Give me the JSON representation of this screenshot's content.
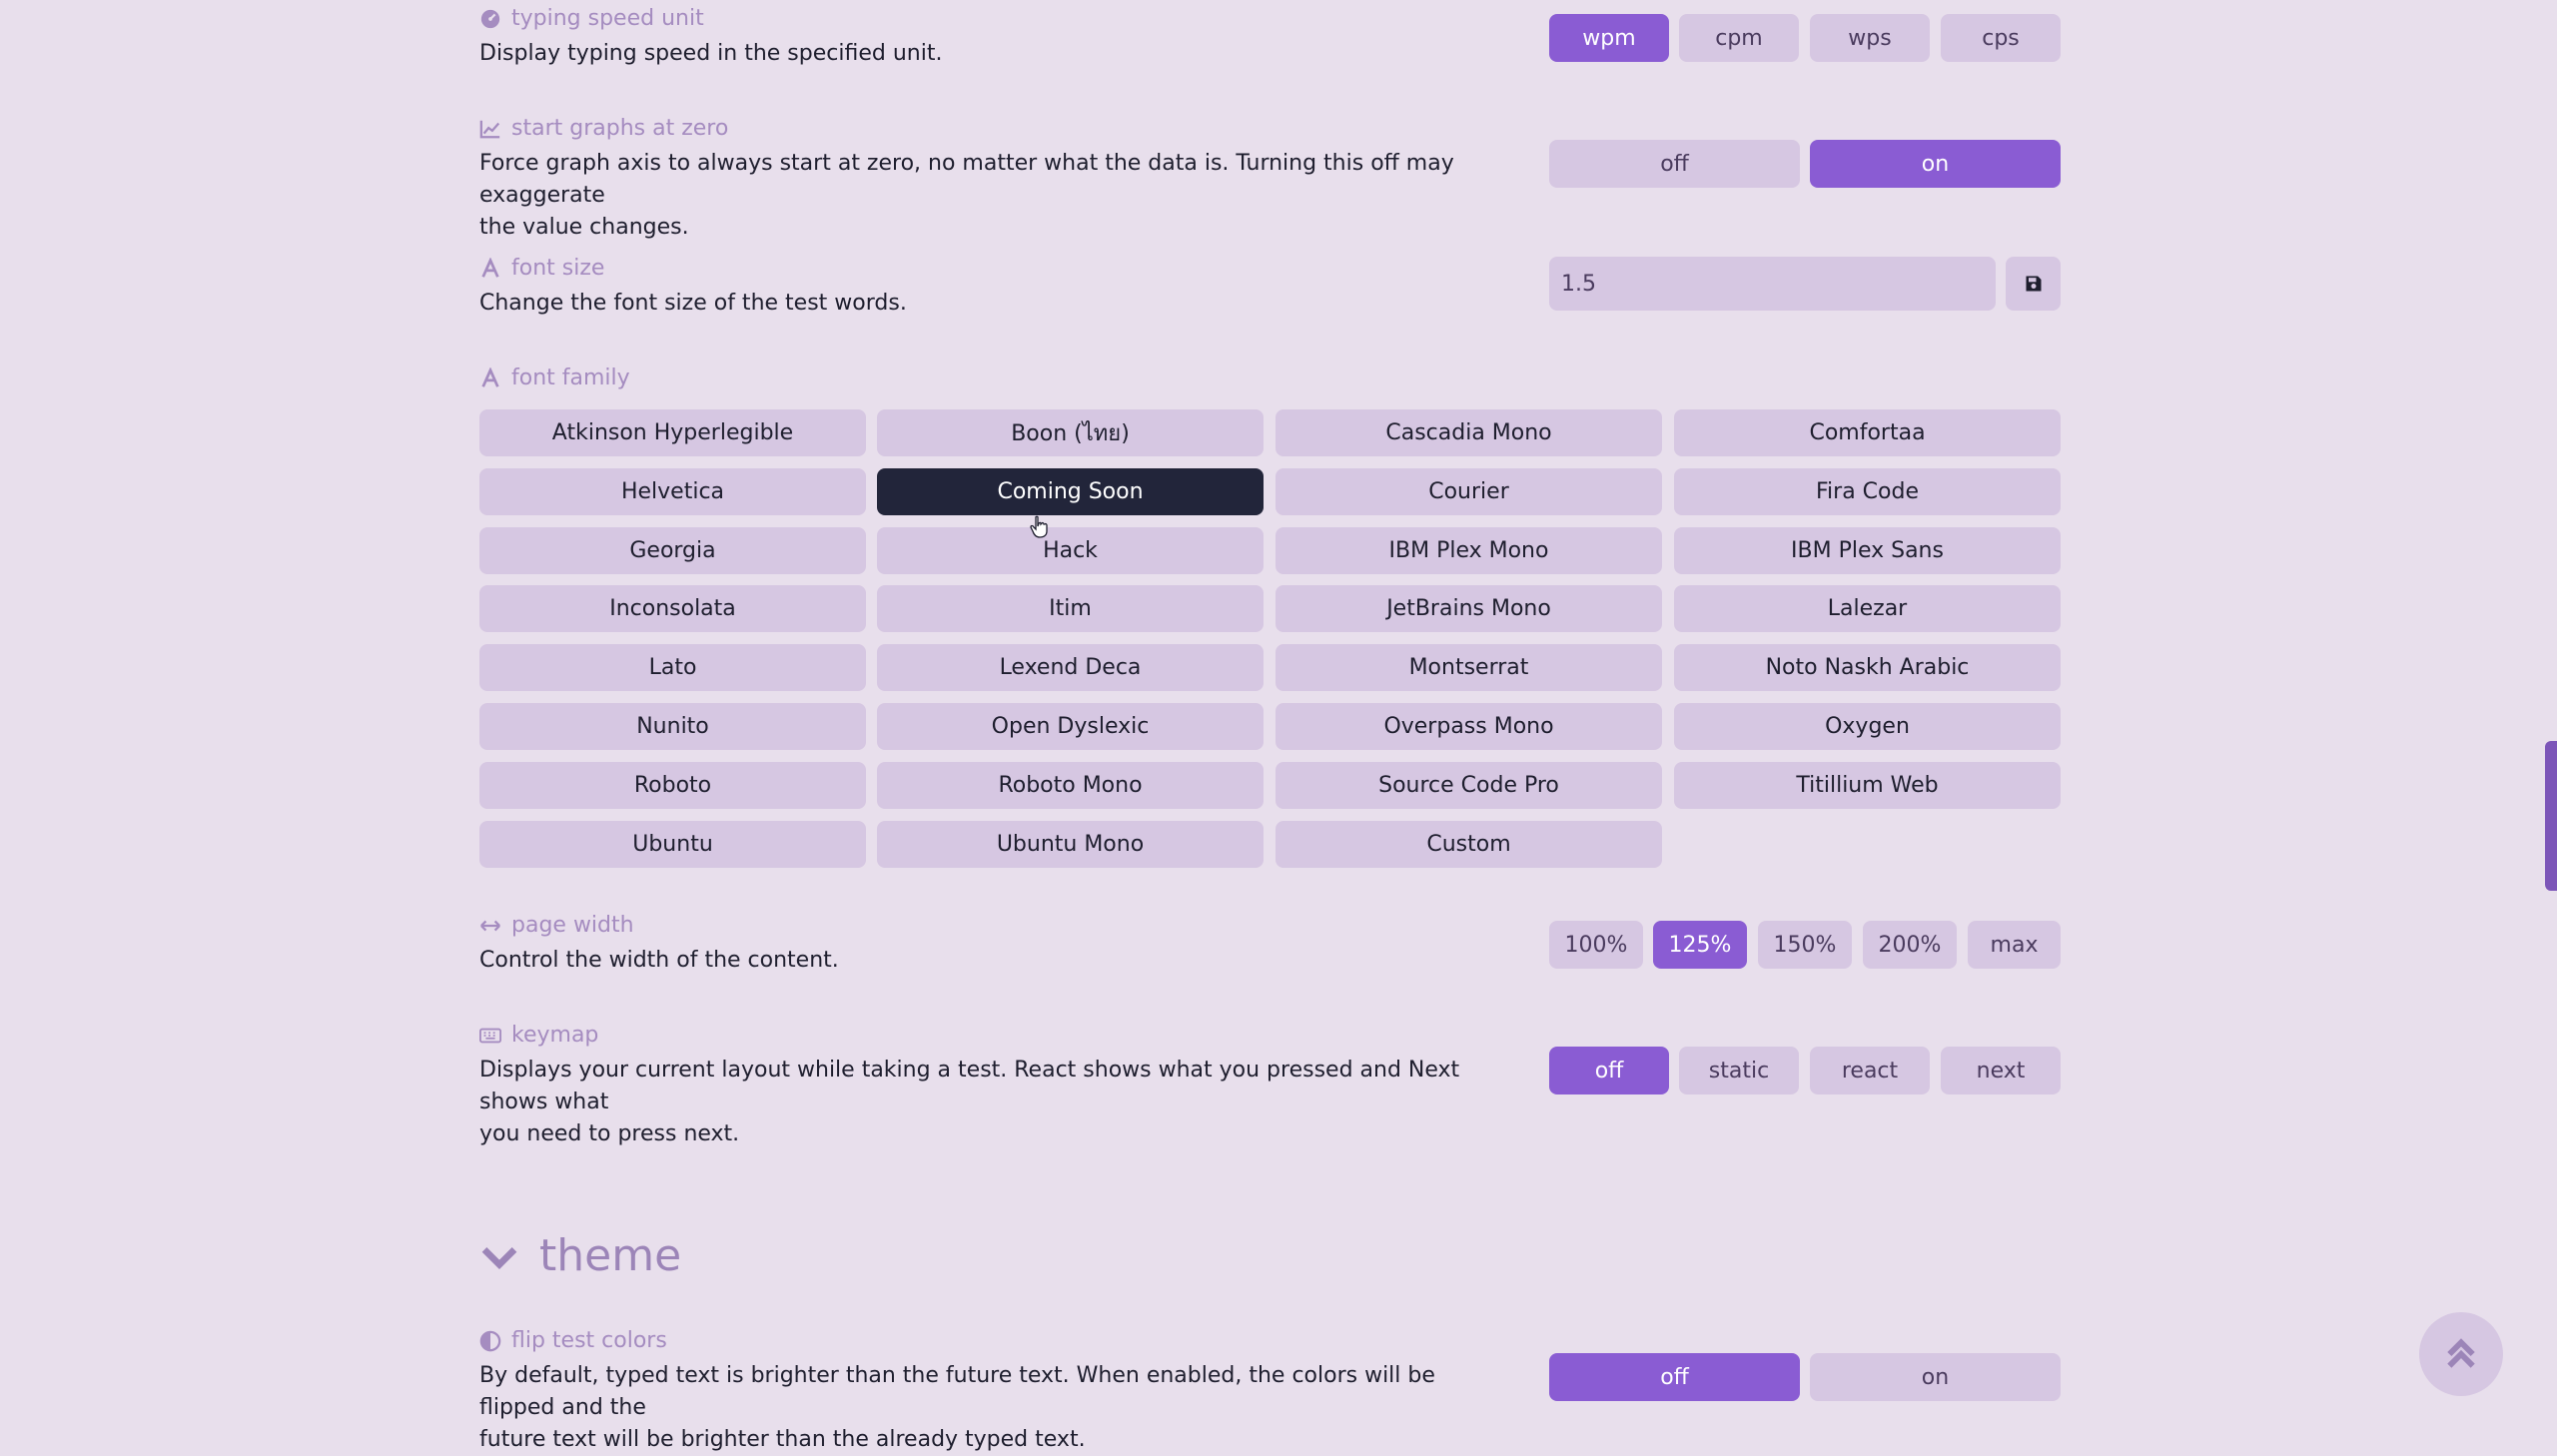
{
  "typing_speed_unit": {
    "title": "typing speed unit",
    "description": "Display typing speed in the specified unit.",
    "options": [
      "wpm",
      "cpm",
      "wps",
      "cps"
    ],
    "selected": "wpm"
  },
  "start_graphs_at_zero": {
    "title": "start graphs at zero",
    "description_line1": "Force graph axis to always start at zero, no matter what the data is. Turning this off may exaggerate",
    "description_line2": "the value changes.",
    "options": [
      "off",
      "on"
    ],
    "selected": "on"
  },
  "font_size": {
    "title": "font size",
    "description": "Change the font size of the test words.",
    "value": "1.5"
  },
  "font_family": {
    "title": "font family",
    "fonts": [
      "Atkinson Hyperlegible",
      "Boon (ไทย)",
      "Cascadia Mono",
      "Comfortaa",
      "Helvetica",
      "Coming Soon",
      "Courier",
      "Fira Code",
      "Georgia",
      "Hack",
      "IBM Plex Mono",
      "IBM Plex Sans",
      "Inconsolata",
      "Itim",
      "JetBrains Mono",
      "Lalezar",
      "Lato",
      "Lexend Deca",
      "Montserrat",
      "Noto Naskh Arabic",
      "Nunito",
      "Open Dyslexic",
      "Overpass Mono",
      "Oxygen",
      "Roboto",
      "Roboto Mono",
      "Source Code Pro",
      "Titillium Web",
      "Ubuntu",
      "Ubuntu Mono",
      "Custom"
    ],
    "selected": "Coming Soon"
  },
  "page_width": {
    "title": "page width",
    "description": "Control the width of the content.",
    "options": [
      "100%",
      "125%",
      "150%",
      "200%",
      "max"
    ],
    "selected": "125%"
  },
  "keymap": {
    "title": "keymap",
    "description_line1": "Displays your current layout while taking a test. React shows what you pressed and Next shows what",
    "description_line2": "you need to press next.",
    "options": [
      "off",
      "static",
      "react",
      "next"
    ],
    "selected": "off"
  },
  "theme_section": {
    "heading": "theme"
  },
  "flip_test_colors": {
    "title": "flip test colors",
    "description_line1": "By default, typed text is brighter than the future text. When enabled, the colors will be flipped and the",
    "description_line2": "future text will be brighter than the already typed text.",
    "options": [
      "off",
      "on"
    ],
    "selected": "off"
  },
  "colors": {
    "background": "#e8dfec",
    "button": "#d6c7e2",
    "accent": "#8a5cd3",
    "highlight": "#22253a",
    "title_text": "#a58cc0"
  }
}
